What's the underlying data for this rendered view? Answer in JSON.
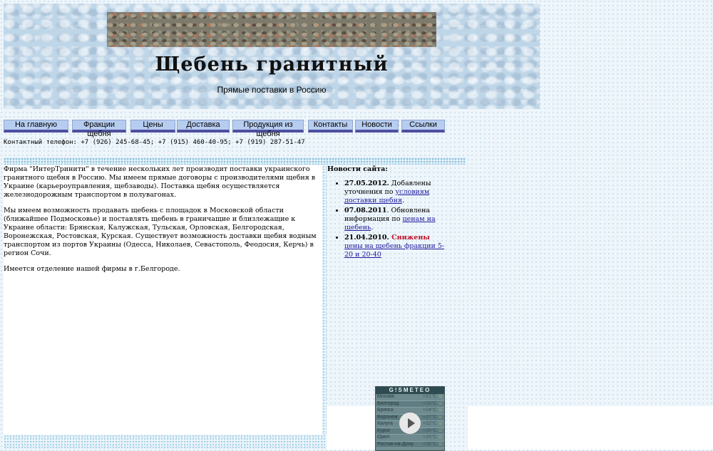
{
  "header": {
    "title": "Щебень гранитный",
    "subtitle": "Прямые поставки в Россию"
  },
  "nav": {
    "items": [
      {
        "label": "На главную"
      },
      {
        "label": "Фракции щебня"
      },
      {
        "label": "Цены"
      },
      {
        "label": "Доставка"
      },
      {
        "label": "Продукция из щебня"
      },
      {
        "label": "Контакты"
      },
      {
        "label": "Новости"
      },
      {
        "label": "Ссылки"
      }
    ]
  },
  "contact": {
    "text": "Контактный телефон: +7 (926) 245-68-45; +7 (915) 460-40-95; +7 (919) 287-51-47"
  },
  "main": {
    "paragraphs": [
      "Фирма \"ИнтерТринити\" в течение нескольких лет производит поставки украинского гранитного щебня в Россию. Мы имеем прямые договоры с производителями щебня в Украине (карьероуправления, щебзаводы). Поставка щебня осуществляется железнодорожным транспортом в полувагонах.",
      "Мы имеем возможность продавать щебень с площадок в Московской области (ближайшее Подмосковье) и поставлять щебень в граничащие и близлежащие к Украине области: Брянская, Калужская, Тульская, Орловская, Белгородская, Воронежская, Ростовская, Курская. Существует возможность доставки щебня водным транспортом из портов Украины (Одесса, Николаев, Севастополь, Феодосия, Керчь) в регион Сочи.",
      "Имеется отделение нашей фирмы в г.Белгороде."
    ]
  },
  "news": {
    "heading": "Новости сайта:",
    "items": [
      {
        "date": "27.05.2012.",
        "text": " Добавлены уточнения по ",
        "link": "условиям доставки щебня",
        "after": "."
      },
      {
        "date": "07.08.2011",
        "text": ". Обновлена информация по ",
        "link": "ценам на щебень",
        "after": "."
      },
      {
        "date": "21.04.2010.",
        "highlight": " Снижены",
        "link": " цены на щебень фракции 5-20 и 20-40",
        "after": ""
      }
    ]
  },
  "weather_widget": {
    "title": "G!SMETEO",
    "rows": [
      {
        "city": "Москва",
        "temp": "+21°C"
      },
      {
        "city": "Белгород",
        "temp": "+26°C"
      },
      {
        "city": "Брянск",
        "temp": "+24°C"
      },
      {
        "city": "Воронеж",
        "temp": "+27°C"
      },
      {
        "city": "Калуга",
        "temp": "+22°C"
      },
      {
        "city": "Курск",
        "temp": "+26°C"
      },
      {
        "city": "Орел",
        "temp": "+25°C"
      },
      {
        "city": "Ростов-на-Дону",
        "temp": "+26°C"
      }
    ],
    "icon": "sun-icon",
    "play_icon": "play-icon"
  }
}
